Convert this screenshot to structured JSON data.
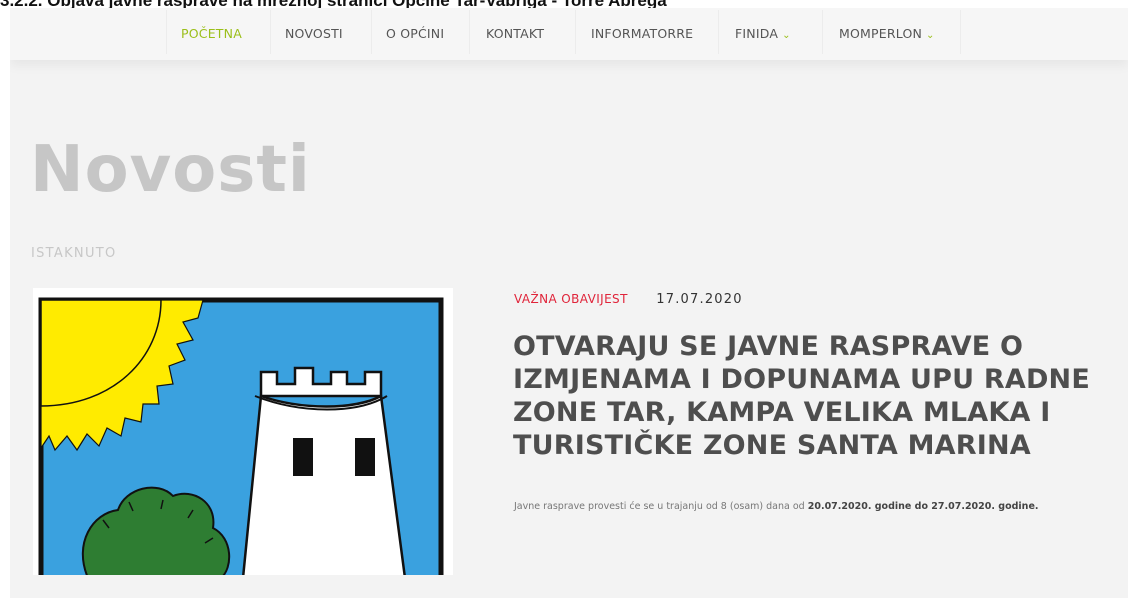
{
  "document_caption": "3.2.2.    Objava javne rasprave na mrežnoj stranici Općine Tar-Vabriga - Torre Abrega",
  "nav": {
    "items": [
      {
        "label": "POČETNA",
        "active": true
      },
      {
        "label": "NOVOSTI"
      },
      {
        "label": "O OPĆINI"
      },
      {
        "label": "KONTAKT"
      },
      {
        "label": "INFORMATORRE"
      },
      {
        "label": "FINIDA",
        "dropdown": true
      },
      {
        "label": "MOMPERLON",
        "dropdown": true
      }
    ],
    "dropdown_icon": "chevron-down-icon"
  },
  "page": {
    "title": "Novosti",
    "section_label": "ISTAKNUTO"
  },
  "featured": {
    "image": "municipal-coat-of-arms: sun, white tower, green tree on blue",
    "category": "VAŽNA OBAVIJEST",
    "date": "17.07.2020",
    "headline": "OTVARAJU SE JAVNE RASPRAVE O IZMJENAMA I DOPUNAMA UPU RADNE ZONE TAR, KAMPA VELIKA MLAKA I TURISTIČKE ZONE SANTA MARINA",
    "summary_prefix": "Javne rasprave provesti će se u trajanju od 8 (osam) dana od ",
    "summary_bold": "20.07.2020. godine do 27.07.2020. godine."
  },
  "colors": {
    "accent_green": "#9bbf1a",
    "category_red": "#e0243a",
    "title_gray": "#c6c6c6",
    "headline_gray": "#4e4e4e",
    "coat_blue": "#3aa1df",
    "sun_yellow": "#ffeb00",
    "tree_green": "#2e7d32"
  }
}
